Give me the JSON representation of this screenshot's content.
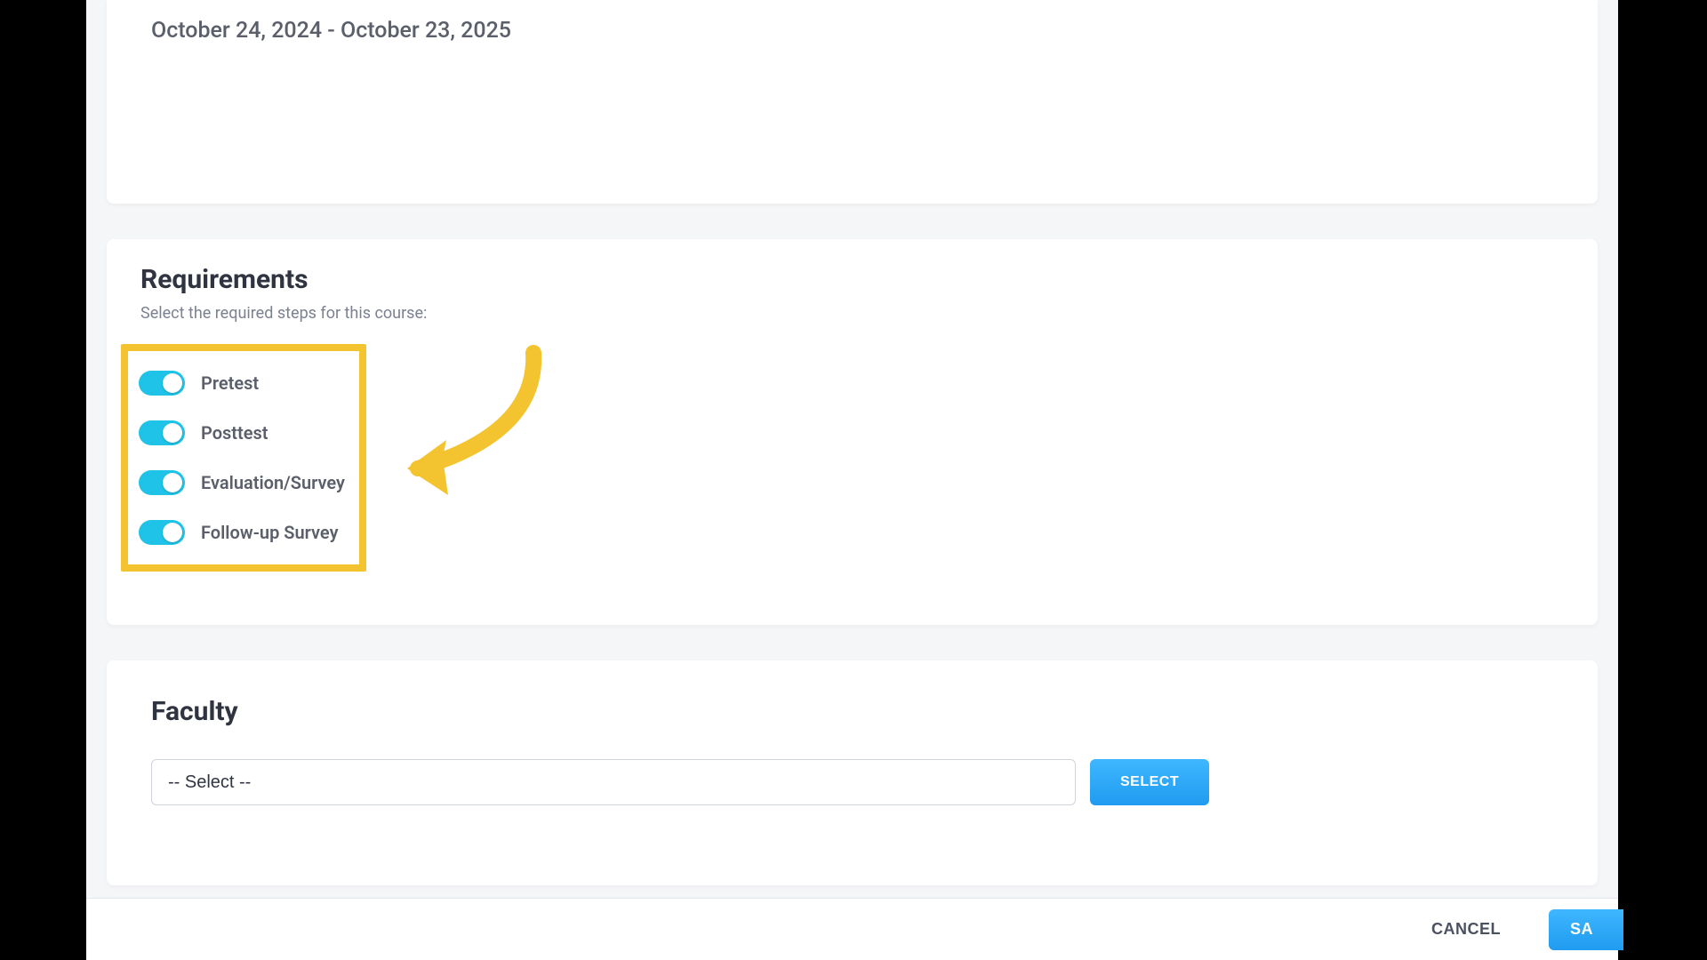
{
  "dates": {
    "range": "October 24, 2024 - October 23, 2025"
  },
  "requirements": {
    "title": "Requirements",
    "subtitle": "Select the required steps for this course:",
    "toggles": [
      {
        "label": "Pretest",
        "on": true
      },
      {
        "label": "Posttest",
        "on": true
      },
      {
        "label": "Evaluation/Survey",
        "on": true
      },
      {
        "label": "Follow-up Survey",
        "on": true
      }
    ]
  },
  "faculty": {
    "title": "Faculty",
    "placeholder": "-- Select --",
    "select_button": "SELECT"
  },
  "footer": {
    "cancel": "CANCEL",
    "save": "SA"
  },
  "colors": {
    "highlight_border": "#f4c430",
    "primary_button": "#1f9bf0",
    "toggle_on": "#1fc3e8"
  }
}
